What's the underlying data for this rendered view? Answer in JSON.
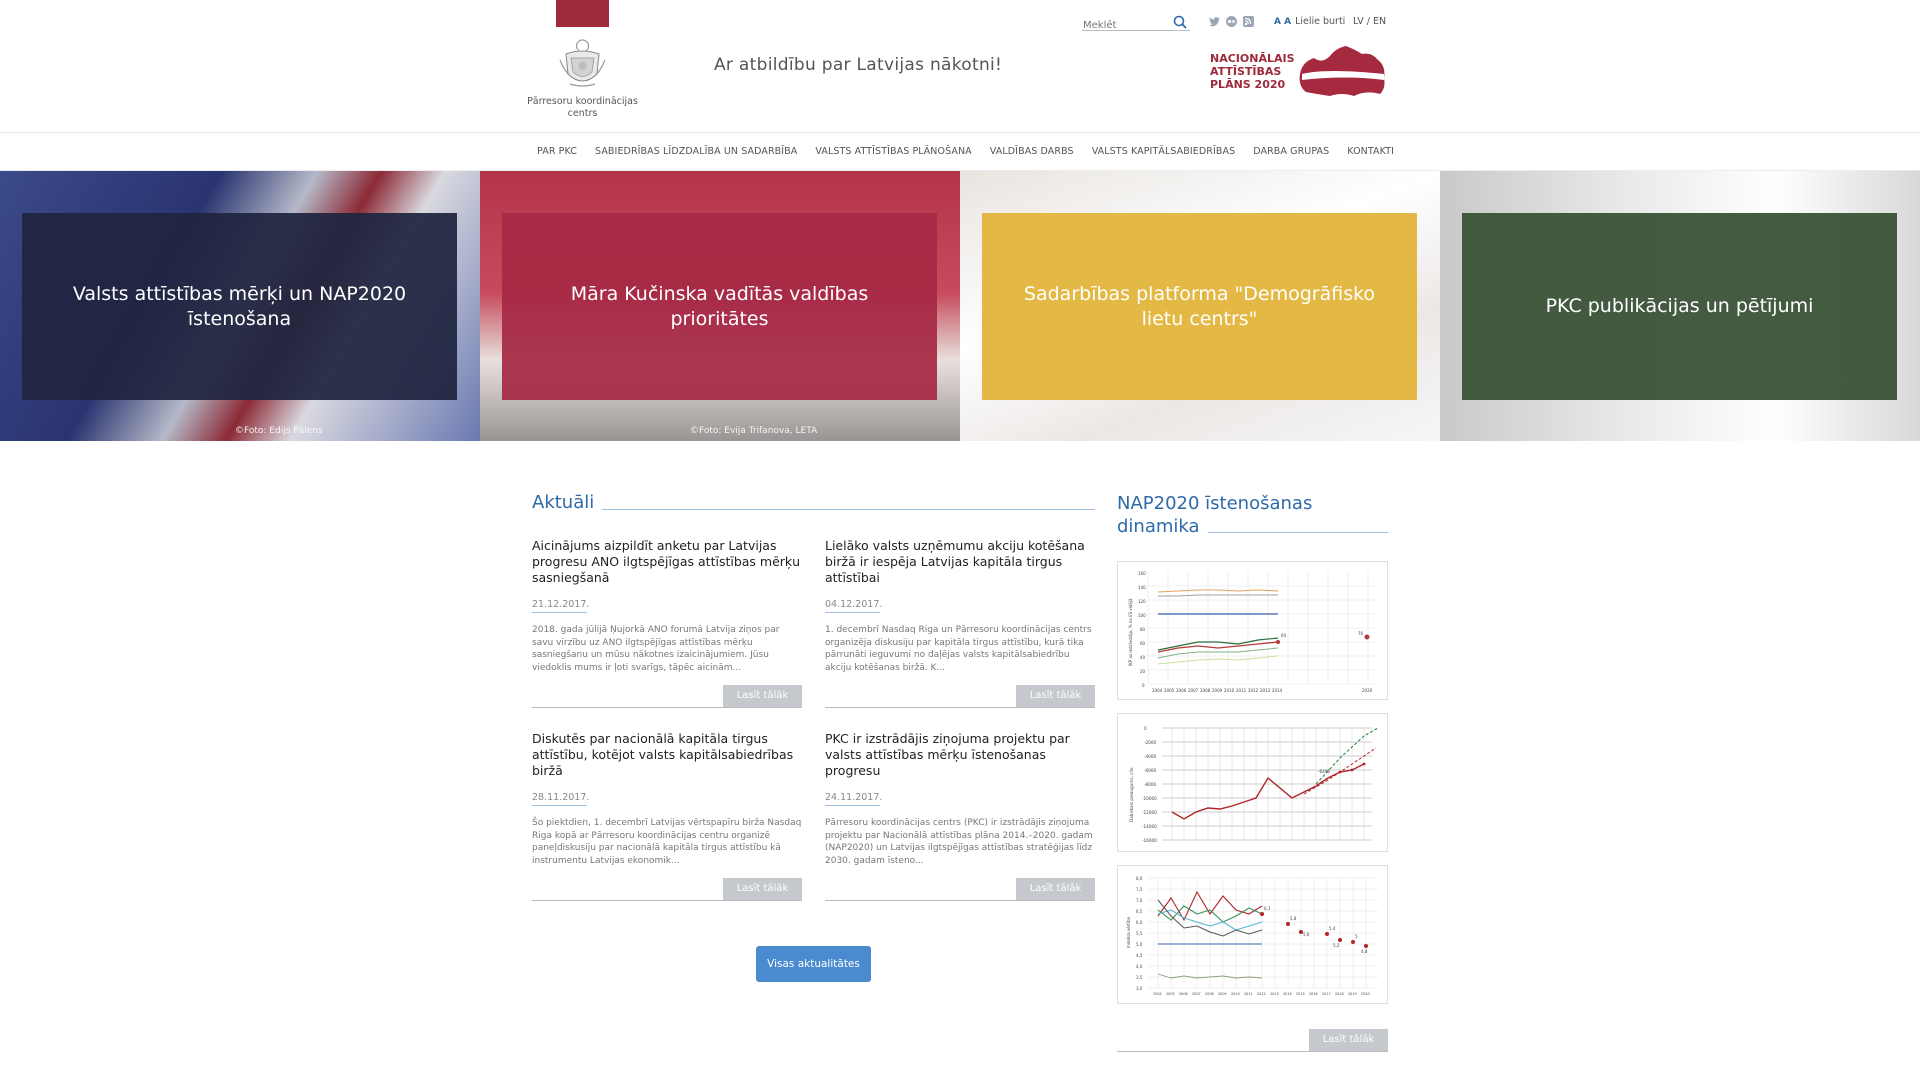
{
  "header": {
    "org_name": "Pārresoru koordinācijas centrs",
    "slogan": "Ar atbildību par Latvijas nākotni!",
    "search_placeholder": "Meklēt",
    "large_font_glyph": "A A",
    "large_font_label": "Lielie burti",
    "lang_lv": "LV",
    "lang_sep": " / ",
    "lang_en": "EN",
    "nap_logo_text": [
      "NACIONĀLAIS",
      "ATTĪSTĪBAS",
      "PLĀNS 2020"
    ],
    "colors": {
      "brand": "#9e2a3c",
      "accent_blue": "#2e6aa8"
    }
  },
  "nav": {
    "items": [
      "PAR PKC",
      "SABIEDRĪBAS LĪDZDALĪBA UN SADARBĪBA",
      "VALSTS ATTĪSTĪBAS PLĀNOŠANA",
      "VALDĪBAS DARBS",
      "VALSTS KAPITĀLSABIEDRĪBAS",
      "DARBA GRUPAS",
      "KONTAKTI"
    ]
  },
  "hero": {
    "tiles": [
      {
        "title": "Valsts attīstības mērķi un NAP2020 īstenošana",
        "photo_credit": "©Foto: Edijs Pālens",
        "box_color": "#1f2540"
      },
      {
        "title": "Māra Kučinska vadītās valdības prioritātes",
        "photo_credit": "©Foto: Evija Trifanova, LETA",
        "box_color": "#a62945"
      },
      {
        "title": "Sadarbības platforma \"Demogrāfisko lietu centrs\"",
        "photo_credit": "",
        "box_color": "#e2b43a"
      },
      {
        "title": "PKC publikācijas un pētījumi",
        "photo_credit": "",
        "box_color": "#3a5238"
      }
    ]
  },
  "news": {
    "title": "Aktuāli",
    "read_more": "Lasīt tālāk",
    "all_button": "Visas aktualitātes",
    "items": [
      {
        "title": "Aicinājums aizpildīt anketu par Latvijas progresu ANO ilgtspējīgas attīstības mērķu sasniegšanā",
        "date": "21.12.2017.",
        "excerpt": "2018. gada jūlijā Ņujorkā ANO forumā Latvija ziņos par savu virzību uz ANO ilgtspējīgas attīstības mērķu sasniegšanu un mūsu nākotnes izaicinājumiem. Jūsu viedoklis mums ir ļoti svarīgs, tāpēc aicinām..."
      },
      {
        "title": "Lielāko valsts uzņēmumu akciju kotēšana biržā ir iespēja Latvijas kapitāla tirgus attīstībai",
        "date": "04.12.2017.",
        "excerpt": "1. decembrī Nasdaq Riga un Pārresoru koordinācijas centrs organizēja diskusiju par kapitāla tirgus attīstību, kurā tika pārrunāti ieguvumi no daļējas valsts kapitālsabiedrību akciju kotēšanas biržā. K..."
      },
      {
        "title": "Diskutēs par nacionālā kapitāla tirgus attīstību, kotējot valsts kapitālsabiedrības biržā",
        "date": "28.11.2017.",
        "excerpt": "Šo piektdien, 1. decembrī Latvijas vērtspapīru birža Nasdaq Riga kopā ar Pārresoru koordinācijas centru organizē paneļdiskusiju par nacionālā kapitāla tirgus attīstību kā instrumentu Latvijas ekonomik..."
      },
      {
        "title": "PKC ir izstrādājis ziņojuma projektu par valsts attīstības mērķu īstenošanas progresu",
        "date": "24.11.2017.",
        "excerpt": "Pārresoru koordinācijas centrs (PKC) ir izstrādājis ziņojuma projektu par Nacionālā attīstības plāna 2014.–2020. gadam (NAP2020) un Latvijas ilgtspējīgas attīstības stratēģijas līdz 2030. gadam īsteno..."
      }
    ]
  },
  "sidebar": {
    "title": "NAP2020 īstenošanas dinamika",
    "read_more": "Lasīt tālāk",
    "charts": [
      {
        "ylabel": "IKP uz iedzīvotāju, % no ES vidējā",
        "y_ticks": [
          "160",
          "140",
          "120",
          "100",
          "80",
          "60",
          "40",
          "20",
          "0"
        ],
        "x_ticks": [
          "2004",
          "2005",
          "2006",
          "2007",
          "2008",
          "2009",
          "2010",
          "2011",
          "2012",
          "2013",
          "2014",
          "2020"
        ],
        "labels": [
          "64",
          "76"
        ]
      },
      {
        "ylabel": "Dabiskais pieaugums, cilv.",
        "y_ticks": [
          "0",
          "-2000",
          "-4000",
          "-6000",
          "-8000",
          "-10000",
          "-12000",
          "-14000",
          "-16000"
        ],
        "labels": [
          "-6495"
        ]
      },
      {
        "ylabel": "Indeksa vērtība",
        "y_ticks": [
          "8,0",
          "7,5",
          "7,0",
          "6,5",
          "6,0",
          "5,5",
          "5,0",
          "4,5",
          "4,0",
          "3,5",
          "3,0"
        ],
        "x_ticks": [
          "2004",
          "2005",
          "2006",
          "2007",
          "2008",
          "2009",
          "2010",
          "2011",
          "2012",
          "2013",
          "2014",
          "2015",
          "2016",
          "2017",
          "2018",
          "2019",
          "2020"
        ],
        "labels": [
          "6,1",
          "5,8",
          "5,6",
          "5,4",
          "5,2",
          "5",
          "4,8"
        ]
      }
    ]
  }
}
